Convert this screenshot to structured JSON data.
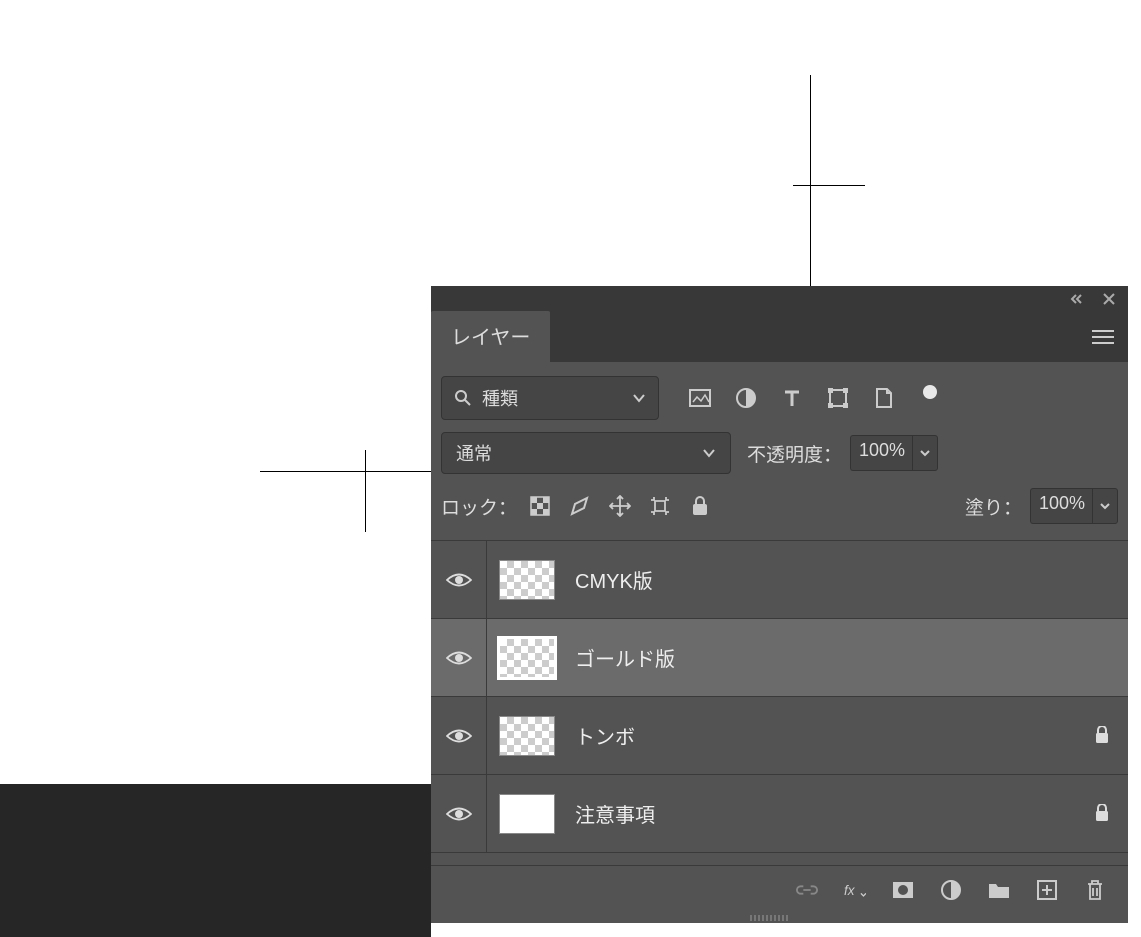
{
  "panel": {
    "tab_label": "レイヤー"
  },
  "filter": {
    "search_label": "種類"
  },
  "blend": {
    "mode_label": "通常",
    "opacity_label": "不透明度：",
    "opacity_value": "100%"
  },
  "lock": {
    "label": "ロック：",
    "fill_label": "塗り：",
    "fill_value": "100%"
  },
  "layers": [
    {
      "name": "CMYK版",
      "visible": true,
      "selected": false,
      "locked": false,
      "thumb": "checker"
    },
    {
      "name": "ゴールド版",
      "visible": true,
      "selected": true,
      "locked": false,
      "thumb": "checker"
    },
    {
      "name": "トンボ",
      "visible": true,
      "selected": false,
      "locked": true,
      "thumb": "checker"
    },
    {
      "name": "注意事項",
      "visible": true,
      "selected": false,
      "locked": true,
      "thumb": "white"
    }
  ]
}
